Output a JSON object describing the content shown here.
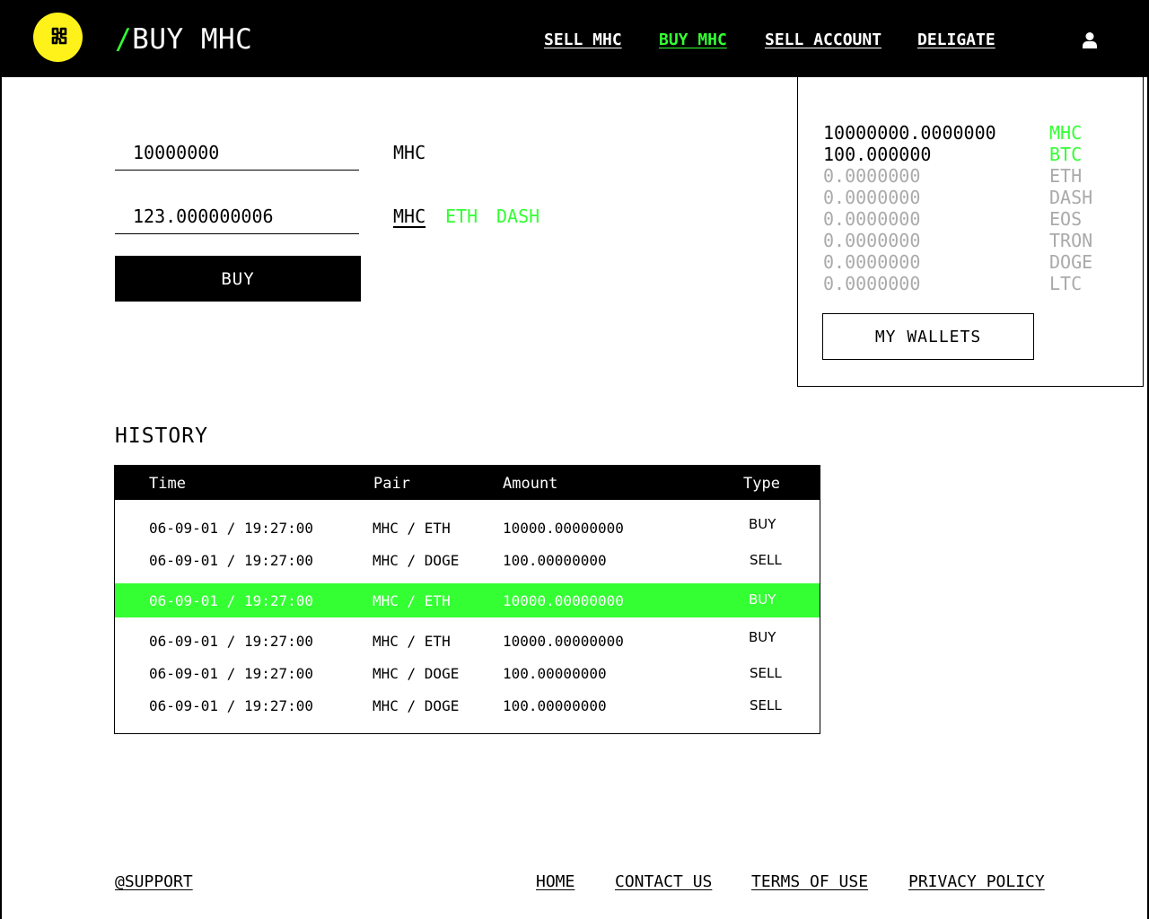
{
  "header": {
    "logo_icon": "puzzle-icon",
    "title_slash": "/",
    "title": "BUY MHC",
    "nav": [
      "SELL MHC",
      "BUY MHC",
      "SELL ACCOUNT",
      "DELIGATE"
    ],
    "active_nav": "BUY MHC",
    "user_icon": "user-icon"
  },
  "form": {
    "amount_value": "10000000",
    "amount_unit": "MHC",
    "pay_value": "123.000000006",
    "pay_currencies": [
      "MHC",
      "ETH",
      "DASH"
    ],
    "selected_currency": "MHC",
    "buy_label": "BUY"
  },
  "wallet": {
    "balances": [
      {
        "value": "10000000.0000000",
        "code": "MHC"
      },
      {
        "value": "100.000000",
        "code": "BTC"
      },
      {
        "value": "0.0000000",
        "code": "ETH"
      },
      {
        "value": "0.0000000",
        "code": "DASH"
      },
      {
        "value": "0.0000000",
        "code": "EOS"
      },
      {
        "value": "0.0000000",
        "code": "TRON"
      },
      {
        "value": "0.0000000",
        "code": "DOGE"
      },
      {
        "value": "0.0000000",
        "code": "LTC"
      }
    ],
    "button_label": "MY WALLETS"
  },
  "history": {
    "heading": "HISTORY",
    "columns": [
      "Time",
      "Pair",
      "Amount",
      "Type"
    ],
    "rows": [
      {
        "time": "06-09-01 / 19:27:00",
        "pair": "MHC / ETH",
        "amount": "10000.00000000",
        "type": "BUY"
      },
      {
        "time": "06-09-01 / 19:27:00",
        "pair": "MHC / DOGE",
        "amount": "100.00000000",
        "type": "SELL"
      },
      {
        "time": "06-09-01 / 19:27:00",
        "pair": "MHC / ETH",
        "amount": "10000.00000000",
        "type": "BUY"
      },
      {
        "time": "06-09-01 / 19:27:00",
        "pair": "MHC / ETH",
        "amount": "10000.00000000",
        "type": "BUY"
      },
      {
        "time": "06-09-01 / 19:27:00",
        "pair": "MHC / DOGE",
        "amount": "100.00000000",
        "type": "SELL"
      },
      {
        "time": "06-09-01 / 19:27:00",
        "pair": "MHC / DOGE",
        "amount": "100.00000000",
        "type": "SELL"
      }
    ],
    "highlighted_row": 2
  },
  "footer": {
    "support": "@SUPPORT",
    "links": [
      "HOME",
      "CONTACT US",
      "TERMS OF USE",
      "PRIVACY POLICY"
    ]
  },
  "colors": {
    "accent": "#33ff33",
    "logo_bg": "#fff21a",
    "header_bg": "#000000",
    "muted": "#aaaaaa"
  }
}
